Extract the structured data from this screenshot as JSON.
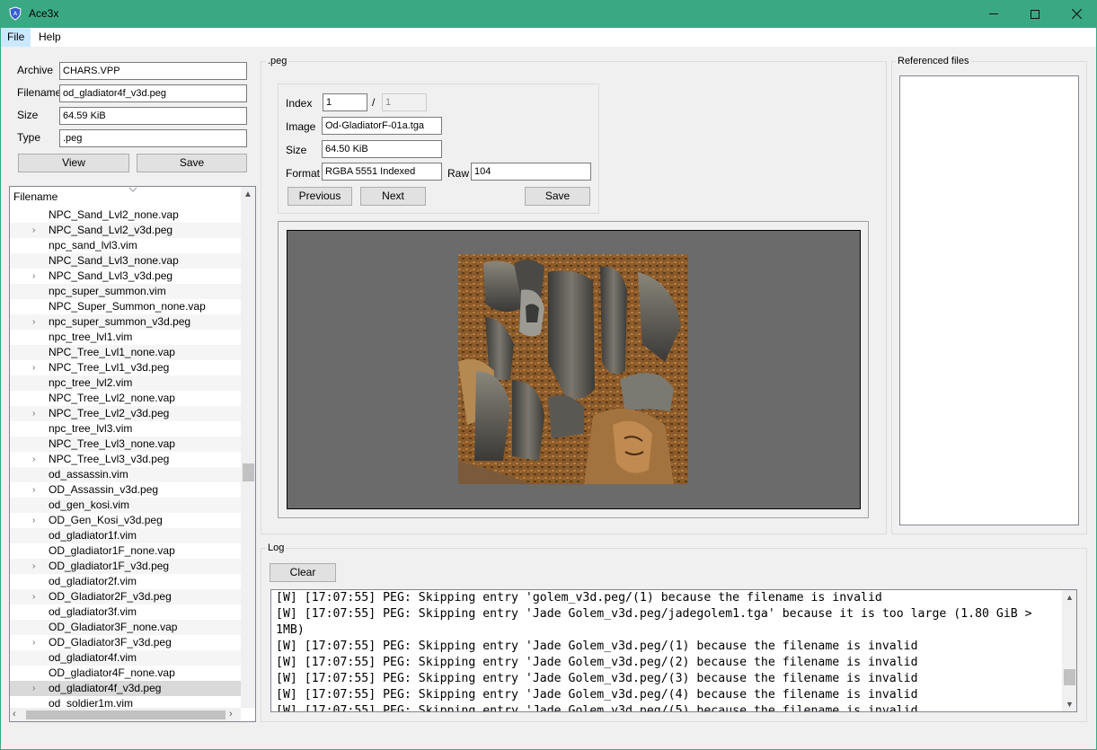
{
  "window": {
    "title": "Ace3x"
  },
  "menu": {
    "items": [
      "File",
      "Help"
    ]
  },
  "archive_info": {
    "archive_label": "Archive",
    "archive_value": "CHARS.VPP",
    "filename_label": "Filename",
    "filename_value": "od_gladiator4f_v3d.peg",
    "size_label": "Size",
    "size_value": "64.59 KiB",
    "type_label": "Type",
    "type_value": ".peg",
    "view_button": "View",
    "save_button": "Save"
  },
  "tree": {
    "header": "Filename",
    "rows": [
      {
        "label": "NPC_Sand_Lvl2_none.vap",
        "expandable": false
      },
      {
        "label": "NPC_Sand_Lvl2_v3d.peg",
        "expandable": true
      },
      {
        "label": "npc_sand_lvl3.vim",
        "expandable": false
      },
      {
        "label": "NPC_Sand_Lvl3_none.vap",
        "expandable": false
      },
      {
        "label": "NPC_Sand_Lvl3_v3d.peg",
        "expandable": true
      },
      {
        "label": "npc_super_summon.vim",
        "expandable": false
      },
      {
        "label": "NPC_Super_Summon_none.vap",
        "expandable": false
      },
      {
        "label": "npc_super_summon_v3d.peg",
        "expandable": true
      },
      {
        "label": "npc_tree_lvl1.vim",
        "expandable": false
      },
      {
        "label": "NPC_Tree_Lvl1_none.vap",
        "expandable": false
      },
      {
        "label": "NPC_Tree_Lvl1_v3d.peg",
        "expandable": true
      },
      {
        "label": "npc_tree_lvl2.vim",
        "expandable": false
      },
      {
        "label": "NPC_Tree_Lvl2_none.vap",
        "expandable": false
      },
      {
        "label": "NPC_Tree_Lvl2_v3d.peg",
        "expandable": true
      },
      {
        "label": "npc_tree_lvl3.vim",
        "expandable": false
      },
      {
        "label": "NPC_Tree_Lvl3_none.vap",
        "expandable": false
      },
      {
        "label": "NPC_Tree_Lvl3_v3d.peg",
        "expandable": true
      },
      {
        "label": "od_assassin.vim",
        "expandable": false
      },
      {
        "label": "OD_Assassin_v3d.peg",
        "expandable": true
      },
      {
        "label": "od_gen_kosi.vim",
        "expandable": false
      },
      {
        "label": "OD_Gen_Kosi_v3d.peg",
        "expandable": true
      },
      {
        "label": "od_gladiator1f.vim",
        "expandable": false
      },
      {
        "label": "OD_gladiator1F_none.vap",
        "expandable": false
      },
      {
        "label": "OD_gladiator1F_v3d.peg",
        "expandable": true
      },
      {
        "label": "od_gladiator2f.vim",
        "expandable": false
      },
      {
        "label": "OD_Gladiator2F_v3d.peg",
        "expandable": true
      },
      {
        "label": "od_gladiator3f.vim",
        "expandable": false
      },
      {
        "label": "OD_Gladiator3F_none.vap",
        "expandable": false
      },
      {
        "label": "OD_Gladiator3F_v3d.peg",
        "expandable": true
      },
      {
        "label": "od_gladiator4f.vim",
        "expandable": false
      },
      {
        "label": "OD_gladiator4F_none.vap",
        "expandable": false
      },
      {
        "label": "od_gladiator4f_v3d.peg",
        "expandable": true,
        "selected": true
      },
      {
        "label": "od_soldier1m.vim",
        "expandable": false
      }
    ]
  },
  "peg": {
    "group_title": ".peg",
    "index_label": "Index",
    "index_value": "1",
    "index_sep": "/",
    "index_total": "1",
    "image_label": "Image",
    "image_value": "Od-GladiatorF-01a.tga",
    "size_label": "Size",
    "size_value": "64.50 KiB",
    "format_label": "Format",
    "format_value": "RGBA 5551 Indexed",
    "raw_label": "Raw",
    "raw_value": "104",
    "previous_button": "Previous",
    "next_button": "Next",
    "save_button": "Save"
  },
  "referenced": {
    "group_title": "Referenced files"
  },
  "log": {
    "group_title": "Log",
    "clear_button": "Clear",
    "lines": [
      "[W] [17:07:55] PEG: Skipping entry 'golem_v3d.peg/(1) because the filename is invalid",
      "[W] [17:07:55] PEG: Skipping entry 'Jade Golem_v3d.peg/jadegolem1.tga' because it is too large (1.80 GiB >",
      "1MB)",
      "[W] [17:07:55] PEG: Skipping entry 'Jade Golem_v3d.peg/(1) because the filename is invalid",
      "[W] [17:07:55] PEG: Skipping entry 'Jade Golem_v3d.peg/(2) because the filename is invalid",
      "[W] [17:07:55] PEG: Skipping entry 'Jade Golem_v3d.peg/(3) because the filename is invalid",
      "[W] [17:07:55] PEG: Skipping entry 'Jade Golem_v3d.peg/(4) because the filename is invalid",
      "[W] [17:07:55] PEG: Skipping entry 'Jade Golem_v3d.peg/(5) because the filename is invalid"
    ]
  },
  "colors": {
    "titlebar": "#3aa983",
    "menu_active": "#cce8ff",
    "canvas": "#6b6b6b"
  }
}
